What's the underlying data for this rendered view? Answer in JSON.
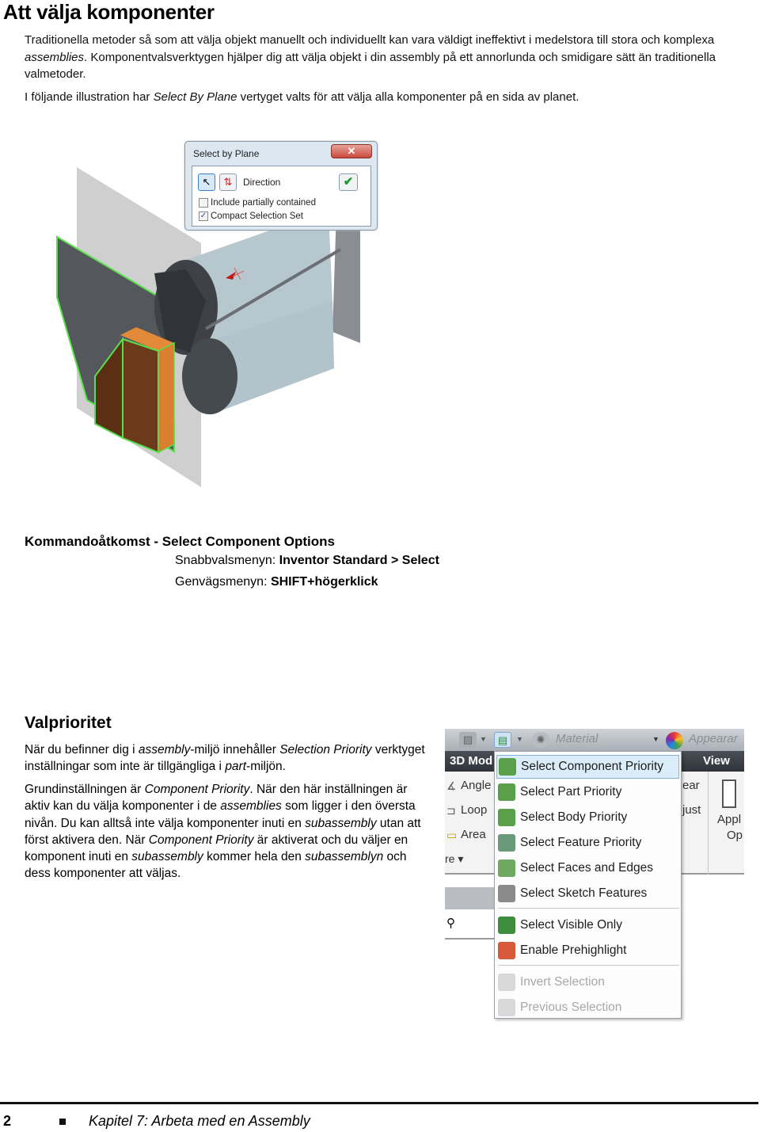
{
  "page": {
    "title": "Att välja komponenter",
    "intro": {
      "p1": [
        {
          "t": "Traditionella metoder så som att välja objekt manuellt och individuellt kan vara väldigt ineffektivt i medelstora till stora och komplexa ",
          "i": false
        },
        {
          "t": "assemblies",
          "i": true
        },
        {
          "t": ". Komponentvalsverktygen hjälper dig att välja objekt i din assembly på ett annorlunda och smidigare sätt än traditionella valmetoder.",
          "i": false
        }
      ],
      "p2": [
        {
          "t": "I följande illustration har ",
          "i": false
        },
        {
          "t": "Select By Plane",
          "i": true
        },
        {
          "t": " vertyget valts för att välja alla komponenter på en sida av planet.",
          "i": false
        }
      ]
    },
    "dialog": {
      "title": "Select by Plane",
      "close_glyph": "✕",
      "direction_label": "Direction",
      "ok_glyph": "✔",
      "include_partial_label": "Include partially contained",
      "include_partial_checked": false,
      "compact_label": "Compact Selection Set",
      "compact_checked": true
    },
    "command_access": {
      "title": "Kommandoåtkomst - Select Component Options",
      "quick_menu_label": "Snabbvalsmenyn: ",
      "quick_menu_value": "Inventor Standard > Select",
      "shortcut_label": "Genvägsmenyn: ",
      "shortcut_value": "SHIFT+högerklick"
    },
    "section": {
      "title": "Valprioritet",
      "p1": [
        {
          "t": "När du befinner dig i ",
          "i": false
        },
        {
          "t": "assembly",
          "i": true
        },
        {
          "t": "-miljö innehåller ",
          "i": false
        },
        {
          "t": "Selection Priority",
          "i": true
        },
        {
          "t": " verktyget inställningar som inte är tillgängliga i ",
          "i": false
        },
        {
          "t": "part",
          "i": true
        },
        {
          "t": "-miljön.",
          "i": false
        }
      ],
      "p2": [
        {
          "t": "Grundinställningen är ",
          "i": false
        },
        {
          "t": "Component Priority",
          "i": true
        },
        {
          "t": ". När den här inställningen är aktiv kan du välja komponenter i de ",
          "i": false
        },
        {
          "t": "assemblies",
          "i": true
        },
        {
          "t": " som ligger i den översta nivån. Du kan alltså inte välja komponenter inuti en ",
          "i": false
        },
        {
          "t": "subassembly",
          "i": true
        },
        {
          "t": " utan att först aktivera den. När ",
          "i": false
        },
        {
          "t": "Component Priority",
          "i": true
        },
        {
          "t": " är aktiverat och du väljer en komponent inuti en ",
          "i": false
        },
        {
          "t": "subassembly",
          "i": true
        },
        {
          "t": " kommer hela den ",
          "i": false
        },
        {
          "t": "subassemblyn",
          "i": true
        },
        {
          "t": " och dess komponenter att väljas.",
          "i": false
        }
      ]
    },
    "ribbon": {
      "material_placeholder": "Material",
      "appearance_label": "Appearar",
      "tab_3d": "3D Mod",
      "tab_view": "View",
      "left_items": [
        "Angle",
        "Loop",
        "Area"
      ],
      "left_more": "re ▾",
      "right_items": [
        "ear",
        "just"
      ],
      "apply_label": "Appl",
      "options_label": "Op"
    },
    "menu": {
      "items": [
        {
          "label": "Select Component Priority",
          "icon": "component-priority-icon",
          "highlighted": true,
          "disabled": false
        },
        {
          "label": "Select Part Priority",
          "icon": "part-priority-icon",
          "highlighted": false,
          "disabled": false
        },
        {
          "label": "Select Body Priority",
          "icon": "body-priority-icon",
          "highlighted": false,
          "disabled": false
        },
        {
          "label": "Select Feature Priority",
          "icon": "feature-priority-icon",
          "highlighted": false,
          "disabled": false
        },
        {
          "label": "Select Faces and Edges",
          "icon": "faces-edges-icon",
          "highlighted": false,
          "disabled": false
        },
        {
          "label": "Select Sketch Features",
          "icon": "sketch-features-icon",
          "highlighted": false,
          "disabled": false
        },
        {
          "label": "Select Visible Only",
          "icon": "visible-only-icon",
          "highlighted": false,
          "disabled": false
        },
        {
          "label": "Enable Prehighlight",
          "icon": "prehighlight-icon",
          "highlighted": false,
          "disabled": false
        },
        {
          "label": "Invert Selection",
          "icon": "invert-selection-icon",
          "highlighted": false,
          "disabled": true
        },
        {
          "label": "Previous Selection",
          "icon": "previous-selection-icon",
          "highlighted": false,
          "disabled": true
        }
      ]
    },
    "footer": {
      "page_number": "2",
      "chapter": "Kapitel 7: Arbeta med en Assembly"
    }
  }
}
